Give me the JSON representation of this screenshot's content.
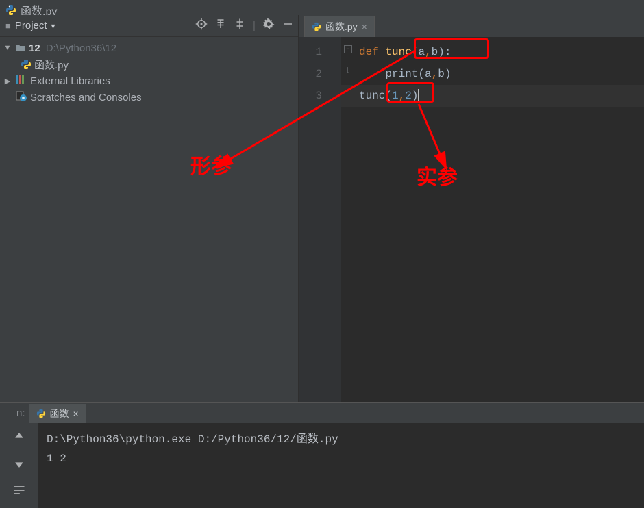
{
  "window": {
    "filename": "函数.py"
  },
  "toolbar": {
    "project_label": "Project"
  },
  "tree": {
    "root_name": "12",
    "root_path": "D:\\Python36\\12",
    "file_name": "函数.py",
    "external_libs": "External Libraries",
    "scratches": "Scratches and Consoles"
  },
  "editor": {
    "tab_name": "函数.py",
    "lines": [
      "1",
      "2",
      "3"
    ],
    "code": {
      "l1_def": "def",
      "l1_fn": "tunc",
      "l1_open": "(",
      "l1_a": "a",
      "l1_c1": ",",
      "l1_b": "b",
      "l1_close": "):",
      "l2_indent": "    ",
      "l2_print": "print",
      "l2_args": "(a",
      "l2_c": ",",
      "l2_b": "b)",
      "l3_fn": "tunc",
      "l3_open": "(",
      "l3_1": "1",
      "l3_c": ",",
      "l3_2": "2",
      "l3_close": ")"
    }
  },
  "annotations": {
    "formal_param": "形参",
    "actual_param": "实参"
  },
  "run": {
    "label_prefix": "n:",
    "tab_name": "函数",
    "cmd": "D:\\Python36\\python.exe D:/Python36/12/函数.py",
    "output": "1 2"
  },
  "icons": {
    "python": "python-icon",
    "folder": "folder-icon",
    "settings": "gear-icon",
    "target": "target-icon",
    "collapse": "collapse-icon",
    "expand": "expand-icon",
    "hide": "hide-icon",
    "close": "close-icon"
  }
}
